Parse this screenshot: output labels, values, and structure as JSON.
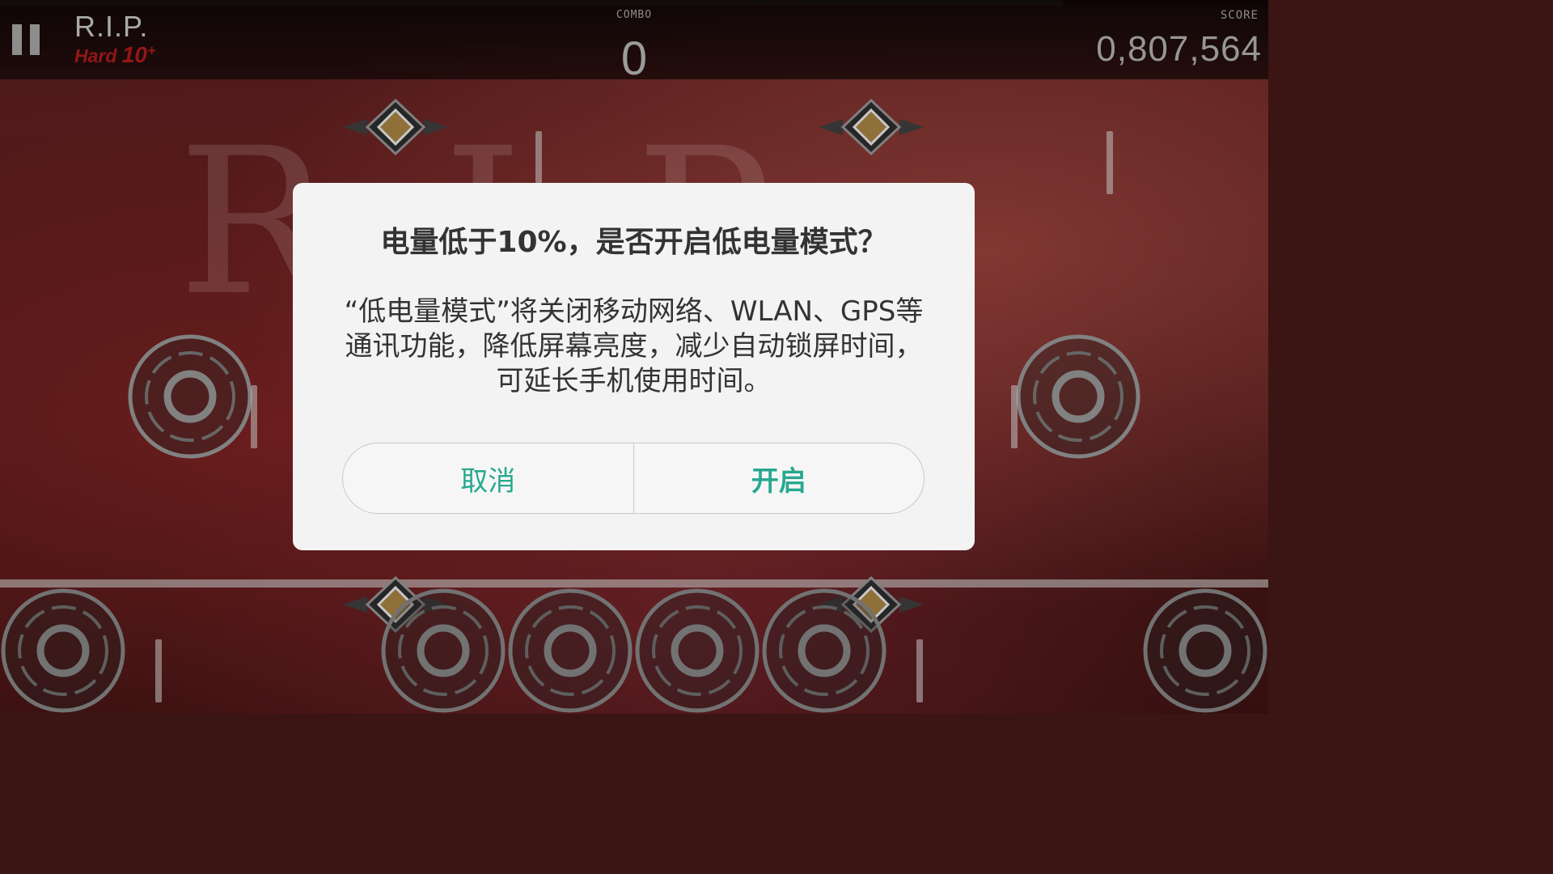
{
  "game": {
    "song_title": "R.I.P.",
    "difficulty_name": "Hard",
    "difficulty_level": "10",
    "difficulty_plus": "+",
    "combo_label": "COMBO",
    "combo_value": "0",
    "score_label": "SCORE",
    "score_value": "0,807,564",
    "background_text": "R.I.P.",
    "progress": 0.838
  },
  "dialog": {
    "title": "电量低于10%，是否开启低电量模式？",
    "message": "“低电量模式”将关闭移动网络、WLAN、GPS等通讯功能，降低屏幕亮度，减少自动锁屏时间，可延长手机使用时间。",
    "cancel_label": "取消",
    "confirm_label": "开启"
  },
  "colors": {
    "accent": "#27a88f",
    "dialog_bg": "#f3f3f3",
    "difficulty": "#a11818"
  },
  "icons": {
    "pause": "pause-icon",
    "tap_note": "diamond-note-icon",
    "hold_ring": "ring-note-icon"
  }
}
